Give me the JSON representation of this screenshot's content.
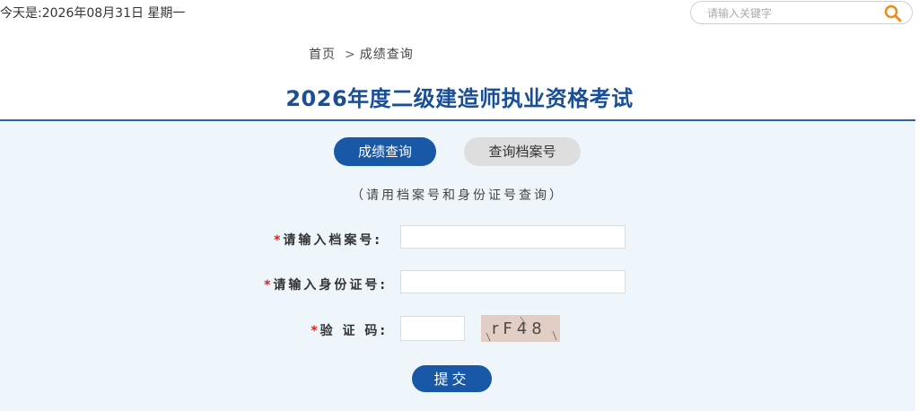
{
  "header": {
    "date_text": "今天是:2026年08月31日 星期一",
    "search_placeholder": "请输入关键字"
  },
  "breadcrumb": {
    "home": "首页",
    "separator": ">",
    "current": "成绩查询"
  },
  "page_title": "2026年度二级建造师执业资格考试",
  "tabs": [
    {
      "label": "成绩查询",
      "active": true
    },
    {
      "label": "查询档案号",
      "active": false
    }
  ],
  "form": {
    "hint": "（请用档案号和身份证号查询）",
    "required_mark": "*",
    "archive_label": "请输入档案号:",
    "id_label": "请输入身份证号:",
    "captcha_label": "验 证 码:",
    "archive_value": "",
    "id_value": "",
    "captcha_value": "",
    "captcha_text": "rF48",
    "submit_label": "提交"
  },
  "colors": {
    "primary": "#1858a6",
    "title": "#1a4f96",
    "panel_bg": "#eef6fb",
    "required": "#d8201c"
  }
}
